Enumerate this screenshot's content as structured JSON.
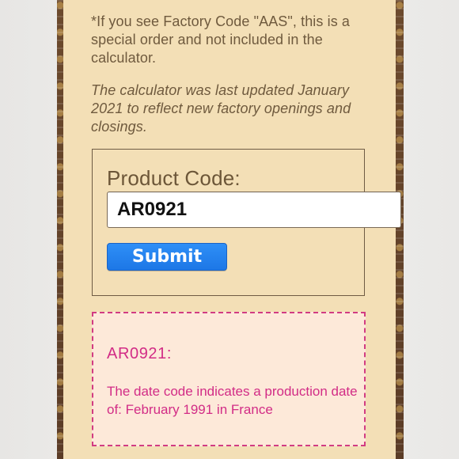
{
  "instructions": {
    "special_order_note": "*If you see Factory Code \"AAS\", this is a special order and not included in the calculator.",
    "update_note": "The calculator was last updated January 2021 to reflect new factory openings and closings."
  },
  "form": {
    "product_code_label": "Product Code:",
    "product_code_value": "AR0921",
    "submit_label": "Submit"
  },
  "result": {
    "title": "AR0921:",
    "message": "The date code indicates a production date of: February 1991 in France"
  },
  "colors": {
    "panel_bg": "#f3dfb6",
    "body_text": "#6f5a3e",
    "submit_bg": "#1d77e6",
    "result_accent": "#d22c86",
    "result_bg": "#fde9d9",
    "strip_brown": "#5a3c27"
  }
}
